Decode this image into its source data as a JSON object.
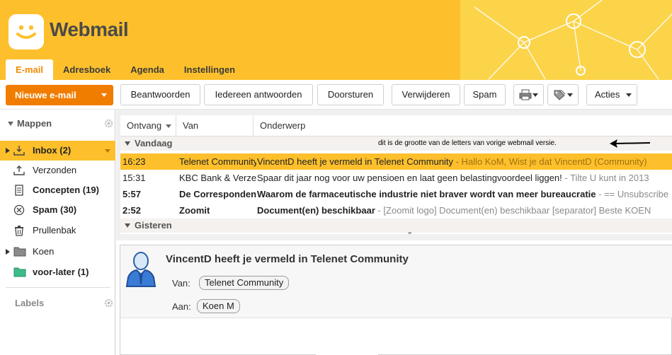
{
  "app": {
    "logo_text": "Webmail"
  },
  "colors": {
    "brand_yellow": "#fdc02c",
    "accent_orange": "#f07d00",
    "active_tab_text": "#f28a00"
  },
  "tabs": [
    {
      "label": "E-mail",
      "active": true
    },
    {
      "label": "Adresboek",
      "active": false
    },
    {
      "label": "Agenda",
      "active": false
    },
    {
      "label": "Instellingen",
      "active": false
    }
  ],
  "toolbar": {
    "new_mail": "Nieuwe e-mail",
    "reply": "Beantwoorden",
    "reply_all": "Iedereen antwoorden",
    "forward": "Doorsturen",
    "delete": "Verwijderen",
    "spam": "Spam",
    "move_icon": "printer-icon",
    "tag_icon": "tag-icon",
    "actions": "Acties"
  },
  "sidebar": {
    "folders_header": "Mappen",
    "labels_header": "Labels",
    "items": [
      {
        "label": "Inbox (2)",
        "icon": "inbox-icon"
      },
      {
        "label": "Verzonden",
        "icon": "sent-icon"
      },
      {
        "label": "Concepten (19)",
        "icon": "drafts-icon"
      },
      {
        "label": "Spam (30)",
        "icon": "spam-icon"
      },
      {
        "label": "Prullenbak",
        "icon": "trash-icon"
      },
      {
        "label": "Koen",
        "icon": "folder-icon"
      },
      {
        "label": "voor-later (1)",
        "icon": "folder-icon"
      }
    ]
  },
  "list": {
    "columns": {
      "received": "Ontvang",
      "from": "Van",
      "subject": "Onderwerp"
    },
    "groups": {
      "today": "Vandaag",
      "yesterday": "Gisteren"
    },
    "annotation": "dit is de grootte van de letters van vorige webmail versie.",
    "rows": [
      {
        "time": "16:23",
        "from": "Telenet Community",
        "subject": "VincentD heeft je vermeld in Telenet Community",
        "preview": " - Hallo KoM, Wist je dat VincentD (Community)"
      },
      {
        "time": "15:31",
        "from": "KBC Bank & Verzekering",
        "subject": "Spaar dit jaar nog voor uw pensioen en laat geen belastingvoordeel liggen!",
        "preview": " - Tilte U kunt in 2013"
      },
      {
        "time": "5:57",
        "from": "De Correspondent",
        "subject": "Waarom de farmaceutische industrie niet braver wordt van meer bureaucratie",
        "preview": " - == Unsubscribe"
      },
      {
        "time": "2:52",
        "from": "Zoomit",
        "subject": "Document(en) beschikbaar",
        "preview": " - [Zoomit logo] Document(en) beschikbaar [separator] Beste KOEN"
      }
    ],
    "grip": "''''''"
  },
  "preview": {
    "subject": "VincentD heeft je vermeld in Telenet Community",
    "from_label": "Van:",
    "from_value": "Telenet Community",
    "to_label": "Aan:",
    "to_value": "Koen M"
  }
}
